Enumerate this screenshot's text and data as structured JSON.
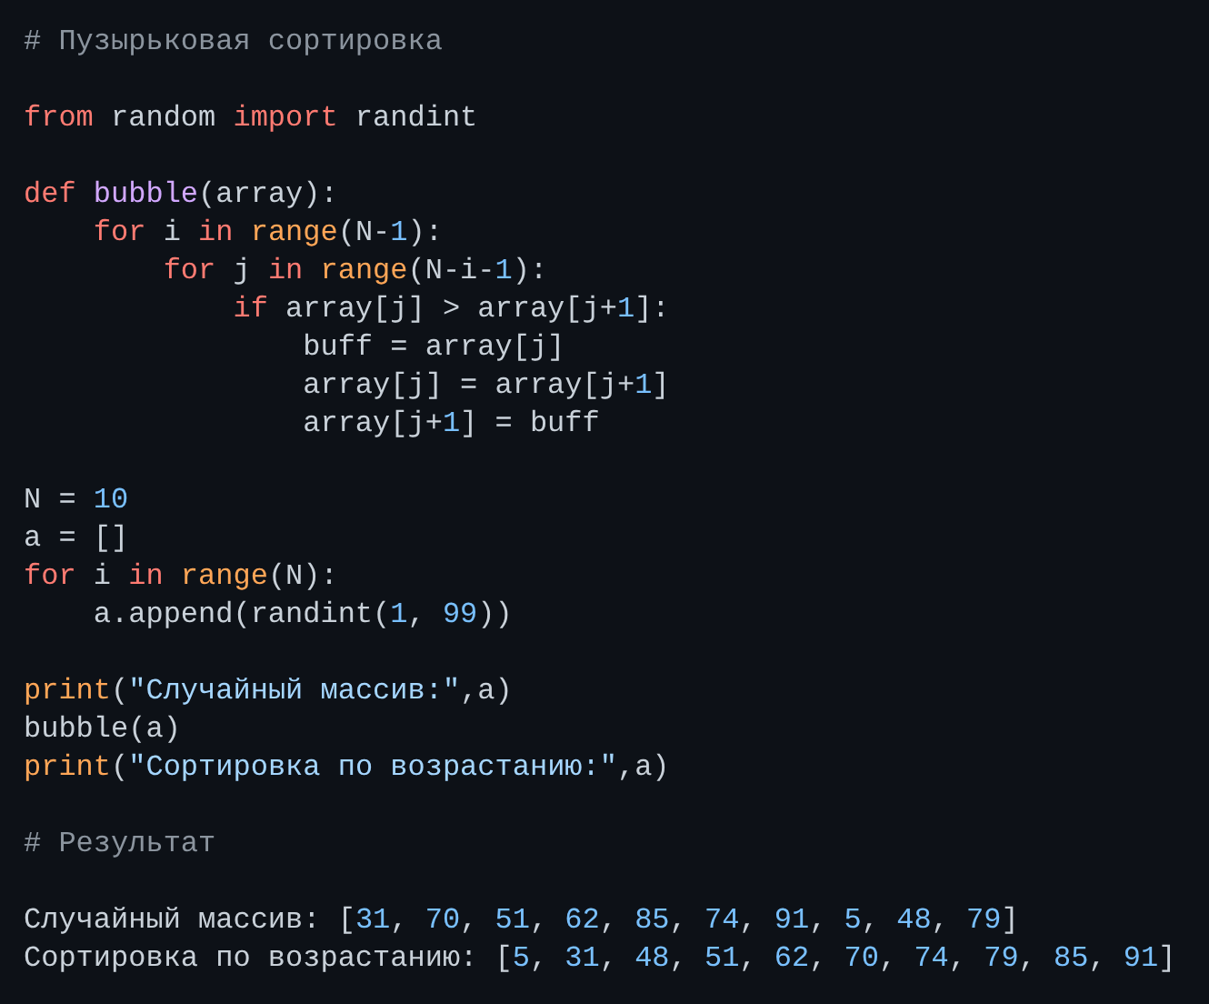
{
  "code_blocks": [
    [
      {
        "tokens": [
          {
            "kind": "comment",
            "text": "# Пузырьковая сортировка"
          }
        ]
      }
    ],
    [
      {
        "tokens": [
          {
            "kind": "keyword",
            "text": "from"
          },
          {
            "kind": "plain",
            "text": " random "
          },
          {
            "kind": "keyword",
            "text": "import"
          },
          {
            "kind": "plain",
            "text": " randint"
          }
        ]
      }
    ],
    [
      {
        "tokens": [
          {
            "kind": "keyword",
            "text": "def"
          },
          {
            "kind": "function",
            "text": " bubble"
          },
          {
            "kind": "plain",
            "text": "(array):"
          }
        ],
        "children": [
          {
            "tokens": [
              {
                "kind": "keyword",
                "text": "for"
              },
              {
                "kind": "plain",
                "text": " i "
              },
              {
                "kind": "keyword",
                "text": "in"
              },
              {
                "kind": "builtin",
                "text": " range"
              },
              {
                "kind": "plain",
                "text": "(N-"
              },
              {
                "kind": "number",
                "text": "1"
              },
              {
                "kind": "plain",
                "text": "):"
              }
            ],
            "children": [
              {
                "tokens": [
                  {
                    "kind": "keyword",
                    "text": "for"
                  },
                  {
                    "kind": "plain",
                    "text": " j "
                  },
                  {
                    "kind": "keyword",
                    "text": "in"
                  },
                  {
                    "kind": "builtin",
                    "text": " range"
                  },
                  {
                    "kind": "plain",
                    "text": "(N-i-"
                  },
                  {
                    "kind": "number",
                    "text": "1"
                  },
                  {
                    "kind": "plain",
                    "text": "):"
                  }
                ],
                "children": [
                  {
                    "tokens": [
                      {
                        "kind": "keyword",
                        "text": "if"
                      },
                      {
                        "kind": "plain",
                        "text": " array[j] > array[j+"
                      },
                      {
                        "kind": "number",
                        "text": "1"
                      },
                      {
                        "kind": "plain",
                        "text": "]:"
                      }
                    ],
                    "children": [
                      {
                        "tokens": [
                          {
                            "kind": "plain",
                            "text": "buff = array[j]"
                          }
                        ]
                      },
                      {
                        "tokens": [
                          {
                            "kind": "plain",
                            "text": "array[j] = array[j+"
                          },
                          {
                            "kind": "number",
                            "text": "1"
                          },
                          {
                            "kind": "plain",
                            "text": "]"
                          }
                        ]
                      },
                      {
                        "tokens": [
                          {
                            "kind": "plain",
                            "text": "array[j+"
                          },
                          {
                            "kind": "number",
                            "text": "1"
                          },
                          {
                            "kind": "plain",
                            "text": "] = buff"
                          }
                        ]
                      }
                    ]
                  }
                ]
              }
            ]
          }
        ]
      }
    ],
    [
      {
        "tokens": [
          {
            "kind": "plain",
            "text": "N = "
          },
          {
            "kind": "number",
            "text": "10"
          }
        ]
      },
      {
        "tokens": [
          {
            "kind": "plain",
            "text": "a = []"
          }
        ]
      },
      {
        "tokens": [
          {
            "kind": "keyword",
            "text": "for"
          },
          {
            "kind": "plain",
            "text": " i "
          },
          {
            "kind": "keyword",
            "text": "in"
          },
          {
            "kind": "builtin",
            "text": " range"
          },
          {
            "kind": "plain",
            "text": "(N):"
          }
        ],
        "children": [
          {
            "tokens": [
              {
                "kind": "plain",
                "text": "a.append(randint("
              },
              {
                "kind": "number",
                "text": "1"
              },
              {
                "kind": "plain",
                "text": ", "
              },
              {
                "kind": "number",
                "text": "99"
              },
              {
                "kind": "plain",
                "text": "))"
              }
            ]
          }
        ]
      }
    ],
    [
      {
        "tokens": [
          {
            "kind": "builtin",
            "text": "print"
          },
          {
            "kind": "plain",
            "text": "("
          },
          {
            "kind": "string",
            "text": "\"Случайный массив:\""
          },
          {
            "kind": "plain",
            "text": ",a)"
          }
        ]
      },
      {
        "tokens": [
          {
            "kind": "plain",
            "text": "bubble(a)"
          }
        ]
      },
      {
        "tokens": [
          {
            "kind": "builtin",
            "text": "print"
          },
          {
            "kind": "plain",
            "text": "("
          },
          {
            "kind": "string",
            "text": "\"Сортировка по возрастанию:\""
          },
          {
            "kind": "plain",
            "text": ",a)"
          }
        ]
      }
    ],
    [
      {
        "tokens": [
          {
            "kind": "comment",
            "text": "# Результат"
          }
        ]
      }
    ],
    [
      {
        "tokens": [
          {
            "kind": "plain",
            "text": "Случайный массив: ["
          },
          {
            "kind": "number",
            "text": "31"
          },
          {
            "kind": "plain",
            "text": ", "
          },
          {
            "kind": "number",
            "text": "70"
          },
          {
            "kind": "plain",
            "text": ", "
          },
          {
            "kind": "number",
            "text": "51"
          },
          {
            "kind": "plain",
            "text": ", "
          },
          {
            "kind": "number",
            "text": "62"
          },
          {
            "kind": "plain",
            "text": ", "
          },
          {
            "kind": "number",
            "text": "85"
          },
          {
            "kind": "plain",
            "text": ", "
          },
          {
            "kind": "number",
            "text": "74"
          },
          {
            "kind": "plain",
            "text": ", "
          },
          {
            "kind": "number",
            "text": "91"
          },
          {
            "kind": "plain",
            "text": ", "
          },
          {
            "kind": "number",
            "text": "5"
          },
          {
            "kind": "plain",
            "text": ", "
          },
          {
            "kind": "number",
            "text": "48"
          },
          {
            "kind": "plain",
            "text": ", "
          },
          {
            "kind": "number",
            "text": "79"
          },
          {
            "kind": "plain",
            "text": "]"
          }
        ]
      },
      {
        "tokens": [
          {
            "kind": "plain",
            "text": "Сортировка по возрастанию: ["
          },
          {
            "kind": "number",
            "text": "5"
          },
          {
            "kind": "plain",
            "text": ", "
          },
          {
            "kind": "number",
            "text": "31"
          },
          {
            "kind": "plain",
            "text": ", "
          },
          {
            "kind": "number",
            "text": "48"
          },
          {
            "kind": "plain",
            "text": ", "
          },
          {
            "kind": "number",
            "text": "51"
          },
          {
            "kind": "plain",
            "text": ", "
          },
          {
            "kind": "number",
            "text": "62"
          },
          {
            "kind": "plain",
            "text": ", "
          },
          {
            "kind": "number",
            "text": "70"
          },
          {
            "kind": "plain",
            "text": ", "
          },
          {
            "kind": "number",
            "text": "74"
          },
          {
            "kind": "plain",
            "text": ", "
          },
          {
            "kind": "number",
            "text": "79"
          },
          {
            "kind": "plain",
            "text": ", "
          },
          {
            "kind": "number",
            "text": "85"
          },
          {
            "kind": "plain",
            "text": ", "
          },
          {
            "kind": "number",
            "text": "91"
          },
          {
            "kind": "plain",
            "text": "]"
          }
        ]
      }
    ]
  ]
}
